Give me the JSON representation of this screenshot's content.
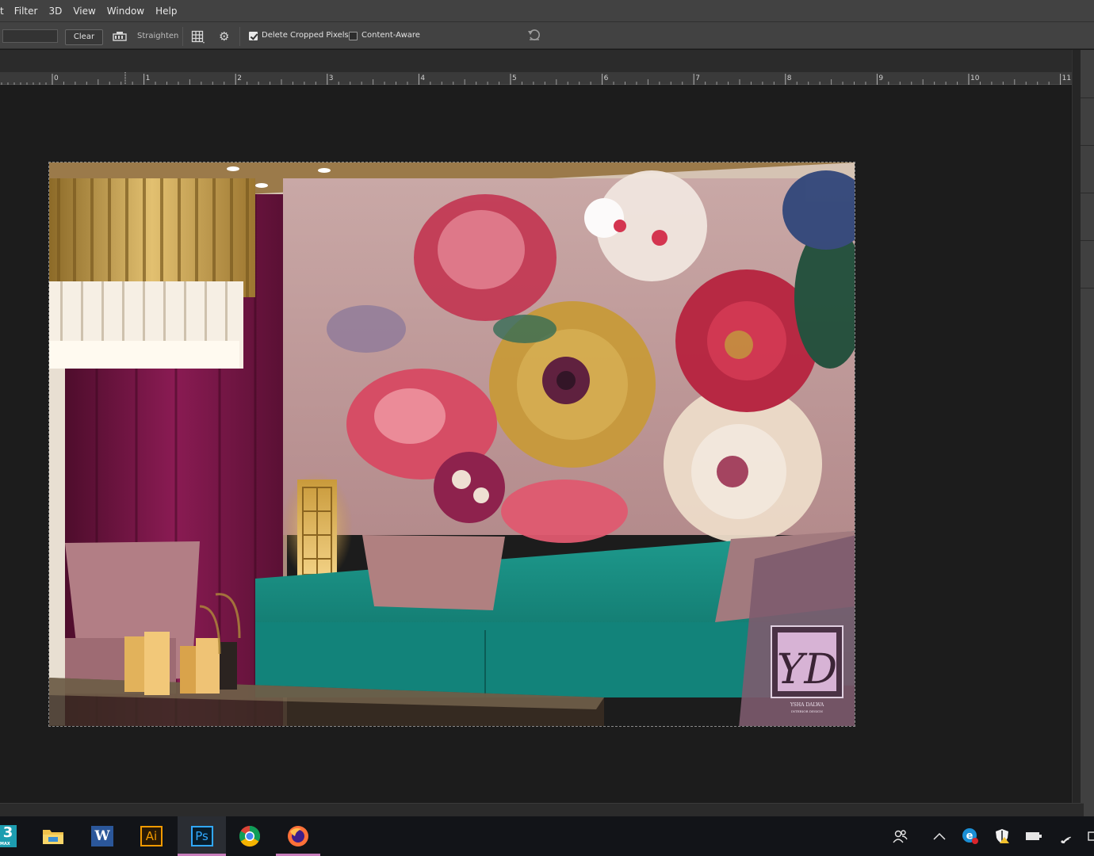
{
  "menu": [
    "t",
    "Filter",
    "3D",
    "View",
    "Window",
    "Help"
  ],
  "options": {
    "clear_label": "Clear",
    "straighten_label": "Straighten",
    "delete_cropped_label": "Delete Cropped Pixels",
    "delete_cropped_checked": true,
    "content_aware_label": "Content-Aware",
    "content_aware_checked": false
  },
  "ruler": {
    "labels": [
      "0",
      "1",
      "2",
      "3",
      "4",
      "5",
      "6",
      "7",
      "8",
      "9",
      "10",
      "11"
    ]
  },
  "document": {
    "description_icon": "image-canvas",
    "watermark": {
      "monogram": "YD",
      "line1": "YSHA DALWA",
      "line2": "INTERIOR DESIGN"
    }
  },
  "taskbar": {
    "apps": [
      {
        "name": "3ds Max",
        "icon": "3dsmax-icon"
      },
      {
        "name": "File Explorer",
        "icon": "folder-icon"
      },
      {
        "name": "Word",
        "icon": "word-icon",
        "glyph": "W"
      },
      {
        "name": "Illustrator",
        "icon": "illustrator-icon",
        "glyph": "Ai"
      },
      {
        "name": "Photoshop",
        "icon": "photoshop-icon",
        "glyph": "Ps"
      },
      {
        "name": "Chrome",
        "icon": "chrome-icon"
      },
      {
        "name": "Firefox",
        "icon": "firefox-icon"
      }
    ],
    "max_glyph": "3",
    "max_sub": "MAX"
  },
  "colors": {
    "chrome_bg": "#424242",
    "canvas_bg": "#1c1c1c",
    "taskbar_bg": "#121418",
    "active_underline": "#c77dbb"
  }
}
